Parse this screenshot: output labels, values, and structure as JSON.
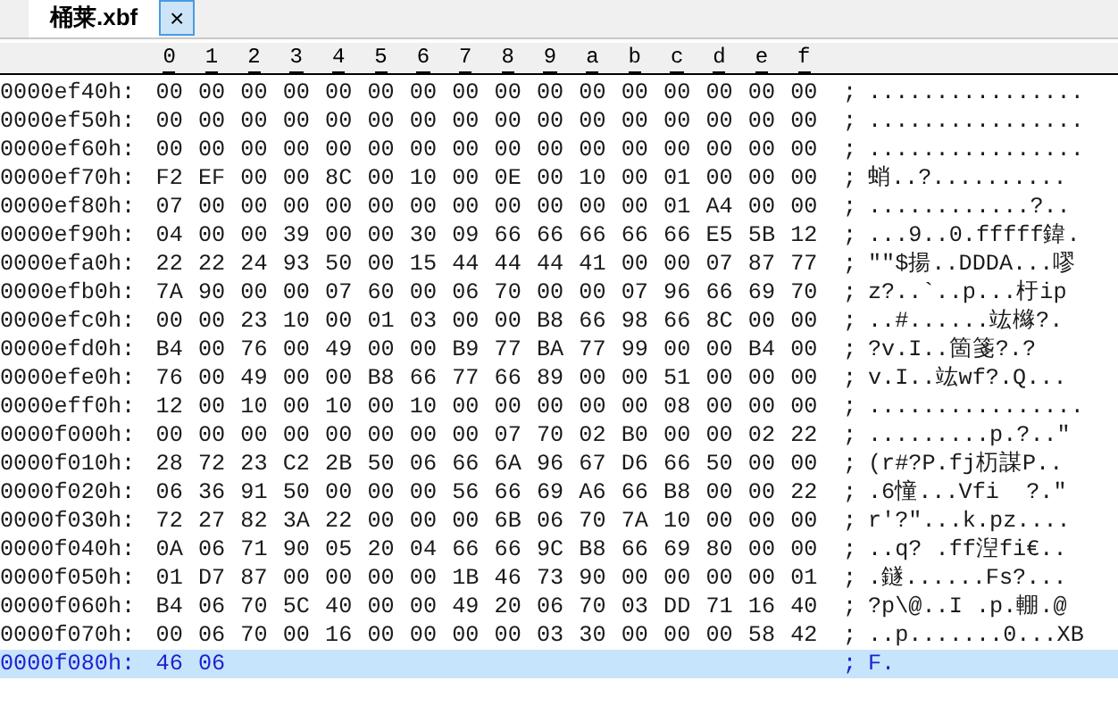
{
  "tabs": [
    {
      "label": "桶莱.xbf",
      "selected": true,
      "close": "×"
    }
  ],
  "columns": [
    "0",
    "1",
    "2",
    "3",
    "4",
    "5",
    "6",
    "7",
    "8",
    "9",
    "a",
    "b",
    "c",
    "d",
    "e",
    "f"
  ],
  "rows": [
    {
      "address": "0000ef40h:",
      "bytes": [
        "00",
        "00",
        "00",
        "00",
        "00",
        "00",
        "00",
        "00",
        "00",
        "00",
        "00",
        "00",
        "00",
        "00",
        "00",
        "00"
      ],
      "separator": ";",
      "ascii": "................",
      "selected": false
    },
    {
      "address": "0000ef50h:",
      "bytes": [
        "00",
        "00",
        "00",
        "00",
        "00",
        "00",
        "00",
        "00",
        "00",
        "00",
        "00",
        "00",
        "00",
        "00",
        "00",
        "00"
      ],
      "separator": ";",
      "ascii": "................",
      "selected": false
    },
    {
      "address": "0000ef60h:",
      "bytes": [
        "00",
        "00",
        "00",
        "00",
        "00",
        "00",
        "00",
        "00",
        "00",
        "00",
        "00",
        "00",
        "00",
        "00",
        "00",
        "00"
      ],
      "separator": ";",
      "ascii": "................",
      "selected": false
    },
    {
      "address": "0000ef70h:",
      "bytes": [
        "F2",
        "EF",
        "00",
        "00",
        "8C",
        "00",
        "10",
        "00",
        "0E",
        "00",
        "10",
        "00",
        "01",
        "00",
        "00",
        "00"
      ],
      "separator": ";",
      "ascii": "蛸..?..........",
      "selected": false
    },
    {
      "address": "0000ef80h:",
      "bytes": [
        "07",
        "00",
        "00",
        "00",
        "00",
        "00",
        "00",
        "00",
        "00",
        "00",
        "00",
        "00",
        "01",
        "A4",
        "00",
        "00"
      ],
      "separator": ";",
      "ascii": "............?..",
      "selected": false
    },
    {
      "address": "0000ef90h:",
      "bytes": [
        "04",
        "00",
        "00",
        "39",
        "00",
        "00",
        "30",
        "09",
        "66",
        "66",
        "66",
        "66",
        "66",
        "E5",
        "5B",
        "12"
      ],
      "separator": ";",
      "ascii": "...9..0.fffff鍏.",
      "selected": false
    },
    {
      "address": "0000efa0h:",
      "bytes": [
        "22",
        "22",
        "24",
        "93",
        "50",
        "00",
        "15",
        "44",
        "44",
        "44",
        "41",
        "00",
        "00",
        "07",
        "87",
        "77"
      ],
      "separator": ";",
      "ascii": "\"\"$揚..DDDA...嘐",
      "selected": false
    },
    {
      "address": "0000efb0h:",
      "bytes": [
        "7A",
        "90",
        "00",
        "00",
        "07",
        "60",
        "00",
        "06",
        "70",
        "00",
        "00",
        "07",
        "96",
        "66",
        "69",
        "70"
      ],
      "separator": ";",
      "ascii": "z?..`..p...杅ip",
      "selected": false
    },
    {
      "address": "0000efc0h:",
      "bytes": [
        "00",
        "00",
        "23",
        "10",
        "00",
        "01",
        "03",
        "00",
        "00",
        "B8",
        "66",
        "98",
        "66",
        "8C",
        "00",
        "00"
      ],
      "separator": ";",
      "ascii": "..#......竑櫞?.",
      "selected": false
    },
    {
      "address": "0000efd0h:",
      "bytes": [
        "B4",
        "00",
        "76",
        "00",
        "49",
        "00",
        "00",
        "B9",
        "77",
        "BA",
        "77",
        "99",
        "00",
        "00",
        "B4",
        "00"
      ],
      "separator": ";",
      "ascii": "?v.I..箇箋?.?",
      "selected": false
    },
    {
      "address": "0000efe0h:",
      "bytes": [
        "76",
        "00",
        "49",
        "00",
        "00",
        "B8",
        "66",
        "77",
        "66",
        "89",
        "00",
        "00",
        "51",
        "00",
        "00",
        "00"
      ],
      "separator": ";",
      "ascii": "v.I..竑wf?.Q...",
      "selected": false
    },
    {
      "address": "0000eff0h:",
      "bytes": [
        "12",
        "00",
        "10",
        "00",
        "10",
        "00",
        "10",
        "00",
        "00",
        "00",
        "00",
        "00",
        "08",
        "00",
        "00",
        "00"
      ],
      "separator": ";",
      "ascii": "................",
      "selected": false
    },
    {
      "address": "0000f000h:",
      "bytes": [
        "00",
        "00",
        "00",
        "00",
        "00",
        "00",
        "00",
        "00",
        "07",
        "70",
        "02",
        "B0",
        "00",
        "00",
        "02",
        "22"
      ],
      "separator": ";",
      "ascii": ".........p.?..\"",
      "selected": false
    },
    {
      "address": "0000f010h:",
      "bytes": [
        "28",
        "72",
        "23",
        "C2",
        "2B",
        "50",
        "06",
        "66",
        "6A",
        "96",
        "67",
        "D6",
        "66",
        "50",
        "00",
        "00"
      ],
      "separator": ";",
      "ascii": "(r#?P.fj杤謀P..",
      "selected": false
    },
    {
      "address": "0000f020h:",
      "bytes": [
        "06",
        "36",
        "91",
        "50",
        "00",
        "00",
        "00",
        "56",
        "66",
        "69",
        "A6",
        "66",
        "B8",
        "00",
        "00",
        "22"
      ],
      "separator": ";",
      "ascii": ".6憧...Vfi  ?.\"",
      "selected": false
    },
    {
      "address": "0000f030h:",
      "bytes": [
        "72",
        "27",
        "82",
        "3A",
        "22",
        "00",
        "00",
        "00",
        "6B",
        "06",
        "70",
        "7A",
        "10",
        "00",
        "00",
        "00"
      ],
      "separator": ";",
      "ascii": "r'?\"...k.pz....",
      "selected": false
    },
    {
      "address": "0000f040h:",
      "bytes": [
        "0A",
        "06",
        "71",
        "90",
        "05",
        "20",
        "04",
        "66",
        "66",
        "9C",
        "B8",
        "66",
        "69",
        "80",
        "00",
        "00"
      ],
      "separator": ";",
      "ascii": "..q? .ff湼fi€..",
      "selected": false
    },
    {
      "address": "0000f050h:",
      "bytes": [
        "01",
        "D7",
        "87",
        "00",
        "00",
        "00",
        "00",
        "1B",
        "46",
        "73",
        "90",
        "00",
        "00",
        "00",
        "00",
        "01"
      ],
      "separator": ";",
      "ascii": ".鐩......Fs?...",
      "selected": false
    },
    {
      "address": "0000f060h:",
      "bytes": [
        "B4",
        "06",
        "70",
        "5C",
        "40",
        "00",
        "00",
        "49",
        "20",
        "06",
        "70",
        "03",
        "DD",
        "71",
        "16",
        "40"
      ],
      "separator": ";",
      "ascii": "?p\\@..I .p.輣.@",
      "selected": false
    },
    {
      "address": "0000f070h:",
      "bytes": [
        "00",
        "06",
        "70",
        "00",
        "16",
        "00",
        "00",
        "00",
        "00",
        "03",
        "30",
        "00",
        "00",
        "00",
        "58",
        "42"
      ],
      "separator": ";",
      "ascii": "..p.......0...XB",
      "selected": false
    },
    {
      "address": "0000f080h:",
      "bytes": [
        "46",
        "06"
      ],
      "separator": ";",
      "ascii": "F.",
      "selected": true
    }
  ]
}
